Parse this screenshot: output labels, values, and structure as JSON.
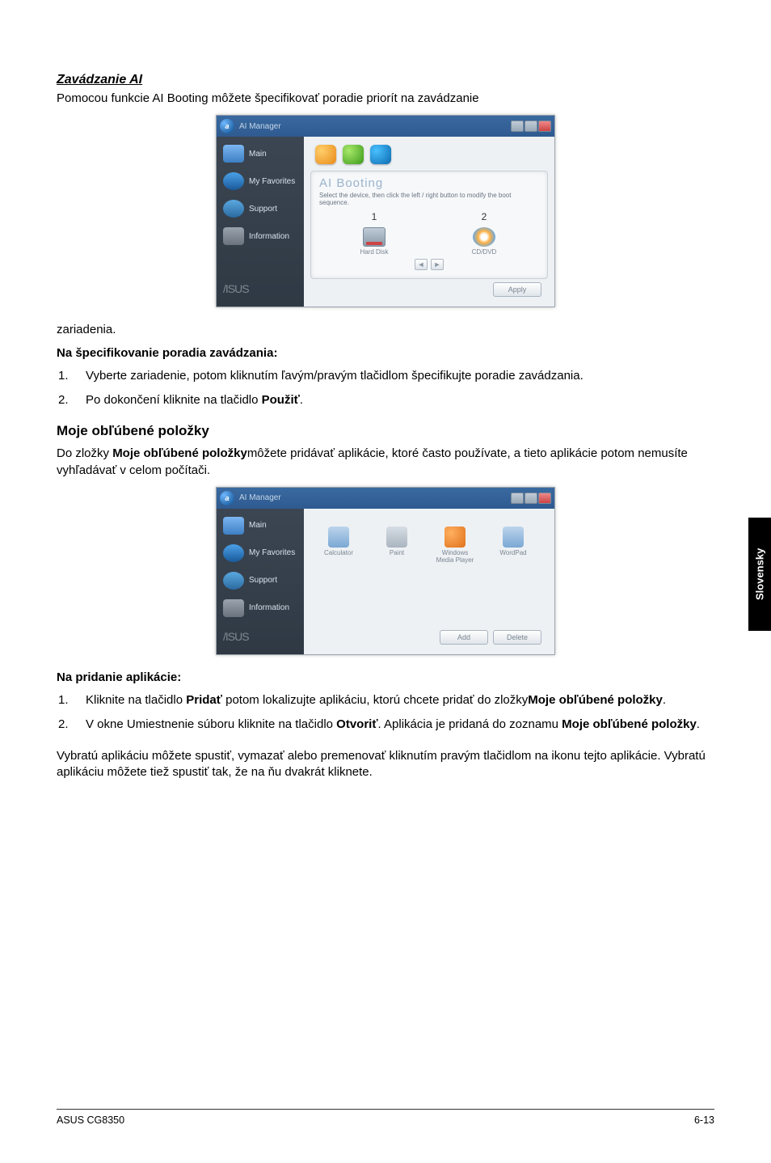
{
  "sections": {
    "booting": {
      "title": "Zavádzanie AI",
      "intro": "Pomocou funkcie AI Booting môžete špecifikovať poradie priorít na zavádzanie",
      "after_img": "zariadenia.",
      "sub_bold": "Na špecifikovanie poradia zavádzania:",
      "steps": {
        "s1": "Vyberte zariadenie, potom kliknutím ľavým/pravým tlačidlom špecifikujte poradie zavádzania.",
        "s2_a": "Po dokončení kliknite na tlačidlo ",
        "s2_b": "Použiť",
        "s2_c": "."
      }
    },
    "favorites": {
      "title": "Moje obľúbené položky",
      "intro_a": "Do zložky ",
      "intro_b": "Moje obľúbené položky",
      "intro_c": "môžete pridávať aplikácie, ktoré často používate, a tieto aplikácie potom nemusíte vyhľadávať v celom počítači.",
      "sub_bold": "Na pridanie aplikácie:",
      "steps": {
        "s1_a": "Kliknite na tlačidlo ",
        "s1_b": "Pridať",
        "s1_c": " potom lokalizujte aplikáciu, ktorú chcete pridať do zložky",
        "s1_d": "Moje obľúbené položky",
        "s1_e": ".",
        "s2_a": "V okne Umiestnenie súboru kliknite na tlačidlo ",
        "s2_b": "Otvoriť",
        "s2_c": ". Aplikácia je pridaná do zoznamu ",
        "s2_d": "Moje obľúbené položky",
        "s2_e": "."
      },
      "outro": "Vybratú aplikáciu môžete spustiť, vymazať alebo premenovať kliknutím pravým tlačidlom na ikonu tejto aplikácie. Vybratú aplikáciu môžete tiež spustiť tak, že na ňu dvakrát kliknete."
    }
  },
  "app": {
    "title": "AI Manager",
    "logo_letter": "a",
    "brand": "/ISUS",
    "sidebar": {
      "main": "Main",
      "favorites": "My Favorites",
      "support": "Support",
      "information": "Information"
    },
    "booting_panel": {
      "title": "AI Booting",
      "desc": "Select the device, then click the left / right button to modify the boot sequence.",
      "col1_num": "1",
      "col2_num": "2",
      "col1_cap": "Hard Disk",
      "col2_cap": "CD/DVD",
      "apply": "Apply"
    },
    "fav_panel": {
      "items": {
        "calc": "Calculator",
        "paint": "Paint",
        "wmp": "Windows Media Player",
        "wordpad": "WordPad"
      },
      "add": "Add",
      "delete": "Delete"
    }
  },
  "sidetab": "Slovensky",
  "footer": {
    "left": "ASUS CG8350",
    "right": "6-13"
  },
  "numbers": {
    "n1": "1.",
    "n2": "2."
  }
}
